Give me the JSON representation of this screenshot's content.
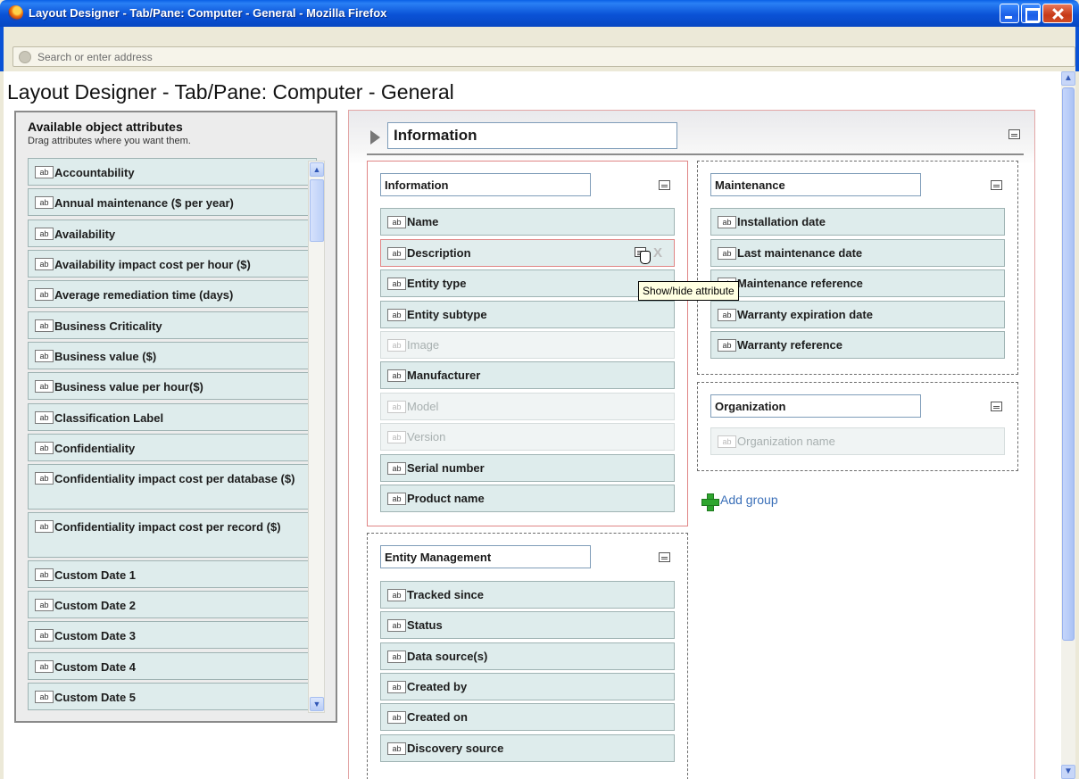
{
  "window": {
    "title": "Layout Designer - Tab/Pane: Computer - General - Mozilla Firefox",
    "address_placeholder": "Search or enter address"
  },
  "page": {
    "title": "Layout Designer - Tab/Pane: Computer - General"
  },
  "available": {
    "title": "Available object attributes",
    "subtitle": "Drag attributes where you want them.",
    "items": [
      "Accountability",
      "Annual maintenance ($ per year)",
      "Availability",
      "Availability impact cost per hour ($)",
      "Average remediation time (days)",
      "Business Criticality",
      "Business value ($)",
      "Business value per hour($)",
      "Classification Label",
      "Confidentiality",
      "Confidentiality impact cost per database ($)",
      "Confidentiality impact cost per record ($)",
      "Custom Date 1",
      "Custom Date 2",
      "Custom Date 3",
      "Custom Date 4",
      "Custom Date 5"
    ]
  },
  "tab": {
    "title": "Information"
  },
  "groups": {
    "information": {
      "title": "Information",
      "items": [
        {
          "label": "Name",
          "hidden": false
        },
        {
          "label": "Description",
          "hidden": false
        },
        {
          "label": "Entity type",
          "hidden": false
        },
        {
          "label": "Entity subtype",
          "hidden": false
        },
        {
          "label": "Image",
          "hidden": true
        },
        {
          "label": "Manufacturer",
          "hidden": false
        },
        {
          "label": "Model",
          "hidden": true
        },
        {
          "label": "Version",
          "hidden": true
        },
        {
          "label": "Serial number",
          "hidden": false
        },
        {
          "label": "Product name",
          "hidden": false
        }
      ]
    },
    "entity_management": {
      "title": "Entity Management",
      "items": [
        {
          "label": "Tracked since",
          "hidden": false
        },
        {
          "label": "Status",
          "hidden": false
        },
        {
          "label": "Data source(s)",
          "hidden": false
        },
        {
          "label": "Created by",
          "hidden": false
        },
        {
          "label": "Created on",
          "hidden": false
        },
        {
          "label": "Discovery source",
          "hidden": false
        }
      ]
    },
    "maintenance": {
      "title": "Maintenance",
      "items": [
        {
          "label": "Installation date",
          "hidden": false
        },
        {
          "label": "Last maintenance date",
          "hidden": false
        },
        {
          "label": "Maintenance reference",
          "hidden": false
        },
        {
          "label": "Warranty expiration date",
          "hidden": false
        },
        {
          "label": "Warranty reference",
          "hidden": false
        }
      ]
    },
    "organization": {
      "title": "Organization",
      "items": [
        {
          "label": "Organization name",
          "hidden": true
        }
      ]
    }
  },
  "tooltip": "Show/hide attribute",
  "add_group_label": "Add group",
  "ab_glyph": "ab",
  "delete_glyph": "X",
  "colors": {
    "titlebar": "#0a52d6",
    "attribute_bg": "#deecec",
    "group_border_selected": "#e08585",
    "link": "#3a6fb8"
  }
}
